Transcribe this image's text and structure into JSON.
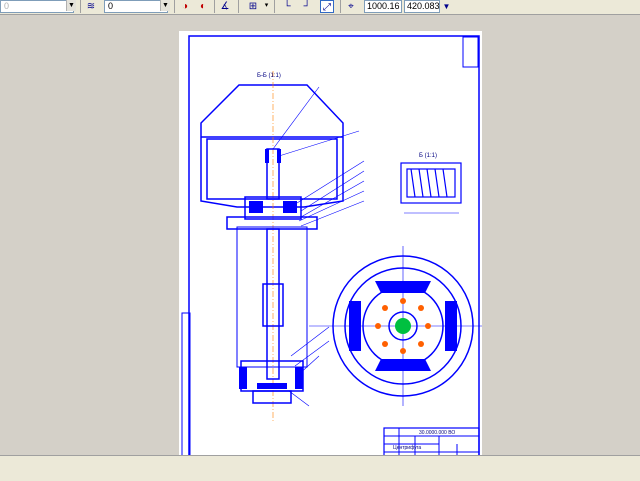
{
  "toolbar": {
    "layer_value": "0",
    "style_value": "0",
    "coord_x": "1000.16",
    "coord_y": "420.083"
  },
  "drawing": {
    "section_label": "Б-Б (1:1)",
    "view_label": "Б (1:1)",
    "title_code": "30.0000.000 ВО",
    "title_name": "Центрифуга"
  },
  "status": {
    "text": ""
  },
  "colors": {
    "line": "#0000ff",
    "background": "#d4d0c8",
    "sheet": "#ffffff"
  }
}
